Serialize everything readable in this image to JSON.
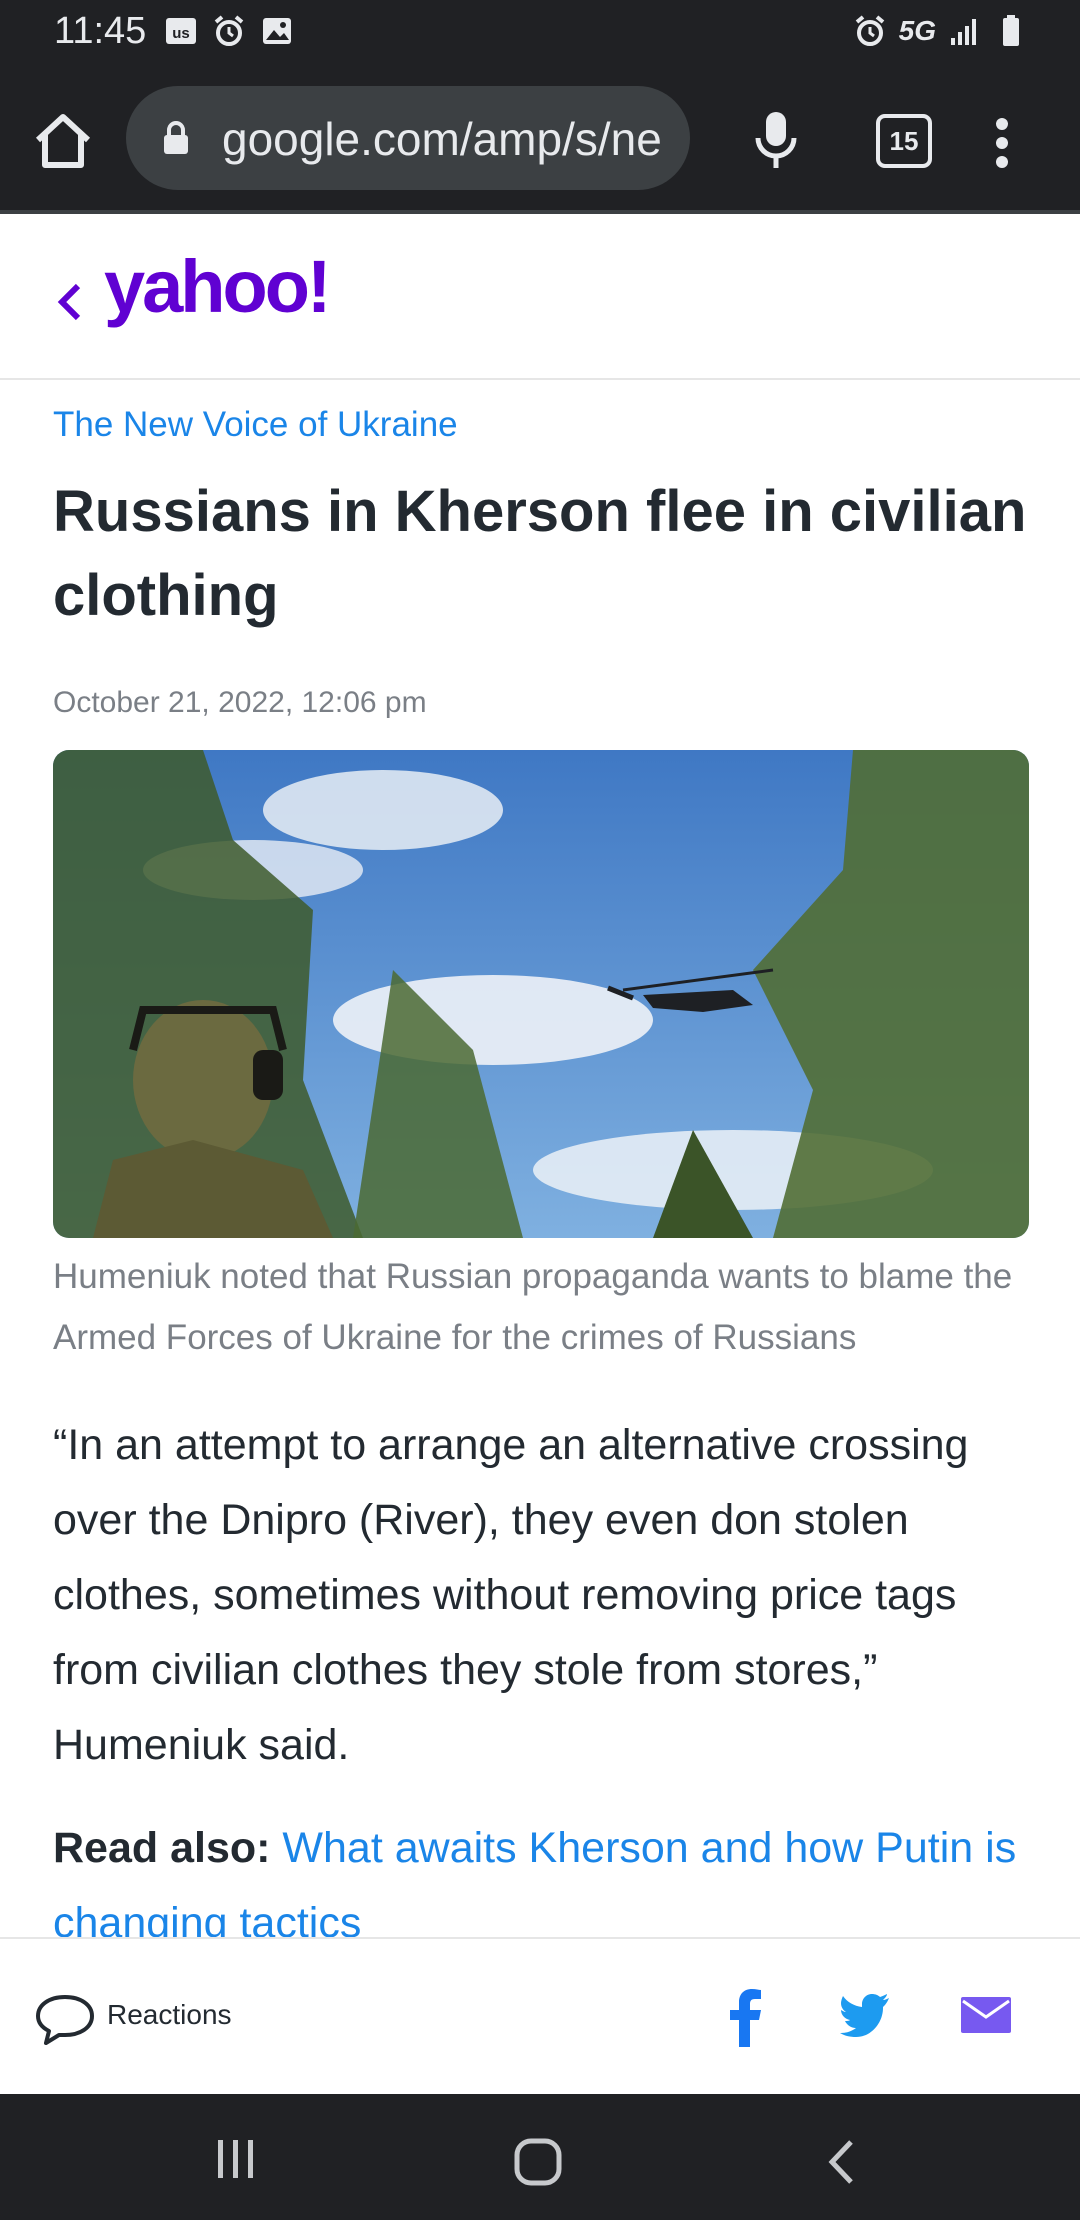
{
  "status_bar": {
    "time": "11:45",
    "left_icons": [
      "us-badge-icon",
      "alarm-icon",
      "image-icon"
    ],
    "network_label": "5G",
    "right_icons": [
      "alarm-icon",
      "signal-icon",
      "battery-icon"
    ]
  },
  "browser": {
    "url": "google.com/amp/s/ne",
    "tab_count": "15"
  },
  "site": {
    "logo": "yahoo!",
    "brand_color": "#6001d2"
  },
  "article": {
    "source": "The New Voice of Ukraine",
    "headline": "Russians in Kherson flee in civilian clothing",
    "date": "October 21, 2022, 12:06 pm",
    "image_caption": "Humeniuk noted that Russian propaganda wants to blame the Armed Forces of Ukraine for the crimes of Russians",
    "body": "“In an attempt to arrange an alternative crossing over the Dnipro (River), they even don stolen clothes, sometimes without removing price tags from civilian clothes they stole from stores,” Humeniuk said.",
    "read_also_label": "Read also:",
    "read_also_link": "What awaits Kherson and how Putin is changing tactics"
  },
  "toolbar": {
    "reactions_label": "Reactions",
    "share_icons": [
      "facebook-icon",
      "twitter-icon",
      "mail-icon"
    ]
  },
  "colors": {
    "link": "#1a85e8",
    "text": "#232a31",
    "muted": "#7a7f86",
    "facebook": "#1877f2",
    "twitter": "#1d9bf0",
    "mail": "#7759f0"
  }
}
